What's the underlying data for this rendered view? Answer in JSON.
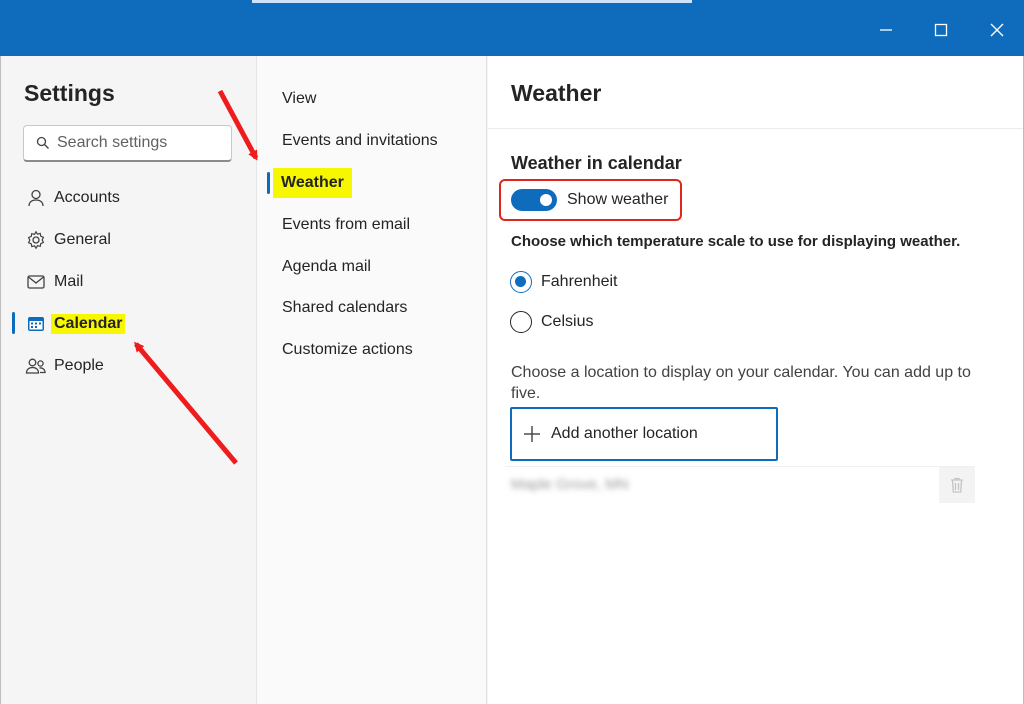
{
  "window": {
    "minimize_icon": "minimize-icon",
    "maximize_icon": "maximize-icon",
    "close_icon": "close-icon"
  },
  "nav": {
    "title": "Settings",
    "search_placeholder": "Search settings",
    "items": [
      {
        "label": "Accounts",
        "icon": "person-icon"
      },
      {
        "label": "General",
        "icon": "gear-icon"
      },
      {
        "label": "Mail",
        "icon": "mail-icon"
      },
      {
        "label": "Calendar",
        "icon": "calendar-icon",
        "active": true
      },
      {
        "label": "People",
        "icon": "people-icon"
      }
    ]
  },
  "subnav": {
    "items": [
      {
        "label": "View"
      },
      {
        "label": "Events and invitations"
      },
      {
        "label": "Weather",
        "active": true
      },
      {
        "label": "Events from email"
      },
      {
        "label": "Agenda mail"
      },
      {
        "label": "Shared calendars"
      },
      {
        "label": "Customize actions"
      }
    ]
  },
  "main": {
    "title": "Weather",
    "section_title": "Weather in calendar",
    "toggle": {
      "label": "Show weather",
      "on": true
    },
    "scale_prompt": "Choose which temperature scale to use for displaying weather.",
    "scales": [
      {
        "label": "Fahrenheit",
        "checked": true
      },
      {
        "label": "Celsius",
        "checked": false
      }
    ],
    "location_prompt": "Choose a location to display on your calendar. You can add up to five.",
    "add_location_label": "Add another location",
    "saved_location": "Maple Grove, MN"
  },
  "colors": {
    "accent": "#0f6cbd",
    "highlight": "#f7f700",
    "annotation": "#e0261b"
  }
}
